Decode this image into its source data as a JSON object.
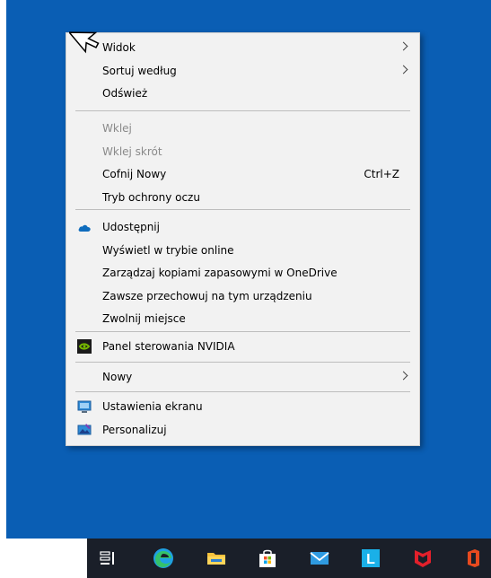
{
  "menu": {
    "view_label": "Widok",
    "sort_label": "Sortuj według",
    "refresh_label": "Odśwież",
    "paste_label": "Wklej",
    "paste_shortcut_label": "Wklej skrót",
    "undo_label": "Cofnij Nowy",
    "undo_shortcut": "Ctrl+Z",
    "eye_protection_label": "Tryb ochrony oczu",
    "share_label": "Udostępnij",
    "view_online_label": "Wyświetl w trybie online",
    "manage_backups_label": "Zarządzaj kopiami zapasowymi w OneDrive",
    "always_keep_label": "Zawsze przechowuj na tym urządzeniu",
    "free_space_label": "Zwolnij miejsce",
    "nvidia_label": "Panel sterowania NVIDIA",
    "new_label": "Nowy",
    "display_settings_label": "Ustawienia ekranu",
    "personalize_label": "Personalizuj"
  },
  "taskbar": {
    "launcher_letter": "L"
  },
  "colors": {
    "desktop": "#0a5eb4",
    "menu_bg": "#f2f2f2",
    "taskbar": "#1a1f29"
  }
}
